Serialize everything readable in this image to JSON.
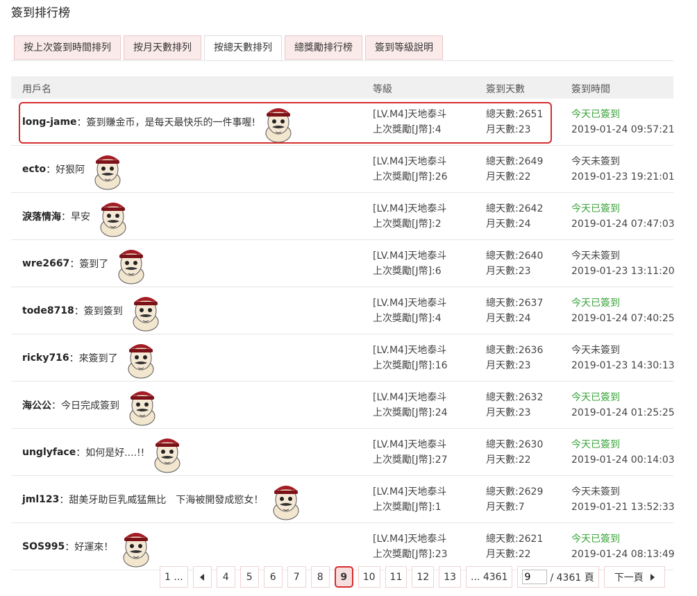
{
  "title": "簽到排行榜",
  "tabs": [
    "按上次簽到時間排列",
    "按月天數排列",
    "按總天數排列",
    "總獎勵排行榜",
    "簽到等級說明"
  ],
  "active_tab": 2,
  "columns": {
    "user": "用戶名",
    "level": "等級",
    "days": "簽到天數",
    "time": "簽到時間"
  },
  "rows": [
    {
      "user": "long-jame",
      "sep": "：",
      "msg": "簽到賺金币，是每天最快乐的一件事喔!",
      "level": "[LV.M4]天地泰斗",
      "reward": "上次獎勵[J幣]:4",
      "total": "總天數:2651",
      "month": "月天數:23",
      "status": "今天已簽到",
      "status_done": true,
      "time": "2019-01-24 09:57:21"
    },
    {
      "user": "ecto",
      "sep": "：",
      "msg": "好狠阿",
      "level": "[LV.M4]天地泰斗",
      "reward": "上次獎勵[J幣]:26",
      "total": "總天數:2649",
      "month": "月天數:22",
      "status": "今天未簽到",
      "status_done": false,
      "time": "2019-01-23 19:21:01"
    },
    {
      "user": "淚落情海",
      "sep": "：",
      "msg": "早安",
      "level": "[LV.M4]天地泰斗",
      "reward": "上次獎勵[J幣]:2",
      "total": "總天數:2642",
      "month": "月天數:24",
      "status": "今天已簽到",
      "status_done": true,
      "time": "2019-01-24 07:47:03"
    },
    {
      "user": "wre2667",
      "sep": "：",
      "msg": "簽到了",
      "level": "[LV.M4]天地泰斗",
      "reward": "上次獎勵[J幣]:6",
      "total": "總天數:2640",
      "month": "月天數:23",
      "status": "今天未簽到",
      "status_done": false,
      "time": "2019-01-23 13:11:20"
    },
    {
      "user": "tode8718",
      "sep": "：",
      "msg": "簽到簽到",
      "level": "[LV.M4]天地泰斗",
      "reward": "上次獎勵[J幣]:4",
      "total": "總天數:2637",
      "month": "月天數:24",
      "status": "今天已簽到",
      "status_done": true,
      "time": "2019-01-24 07:40:25"
    },
    {
      "user": "ricky716",
      "sep": "：",
      "msg": "來簽到了",
      "level": "[LV.M4]天地泰斗",
      "reward": "上次獎勵[J幣]:16",
      "total": "總天數:2636",
      "month": "月天數:23",
      "status": "今天未簽到",
      "status_done": false,
      "time": "2019-01-23 14:30:13"
    },
    {
      "user": "海公公",
      "sep": "：",
      "msg": "今日完成簽到",
      "level": "[LV.M4]天地泰斗",
      "reward": "上次獎勵[J幣]:24",
      "total": "總天數:2632",
      "month": "月天數:23",
      "status": "今天已簽到",
      "status_done": true,
      "time": "2019-01-24 01:25:25"
    },
    {
      "user": "unglyface",
      "sep": "：",
      "msg": "如何是好....!!",
      "level": "[LV.M4]天地泰斗",
      "reward": "上次獎勵[J幣]:27",
      "total": "總天數:2630",
      "month": "月天數:22",
      "status": "今天已簽到",
      "status_done": true,
      "time": "2019-01-24 00:14:03"
    },
    {
      "user": "jml123",
      "sep": "：",
      "msg": "甜美牙助巨乳威猛無比　下海被開發成慾女！",
      "level": "[LV.M4]天地泰斗",
      "reward": "上次獎勵[J幣]:1",
      "total": "總天數:2629",
      "month": "月天數:7",
      "status": "今天未簽到",
      "status_done": false,
      "time": "2019-01-21 13:52:33"
    },
    {
      "user": "SOS995",
      "sep": "：",
      "msg": "好運來！",
      "level": "[LV.M4]天地泰斗",
      "reward": "上次獎勵[J幣]:23",
      "total": "總天數:2621",
      "month": "月天數:22",
      "status": "今天已簽到",
      "status_done": true,
      "time": "2019-01-24 08:13:49"
    }
  ],
  "colors": {
    "done": "#3aa33a",
    "highlight": "#d62c2c",
    "tab_bg": "#fbeaea"
  },
  "pagination": {
    "first": "1 ...",
    "prev_icon": "triangle-left-icon",
    "pages": [
      "4",
      "5",
      "6",
      "7",
      "8",
      "9",
      "10",
      "11",
      "12",
      "13"
    ],
    "current": "9",
    "last": "... 4361",
    "input_value": "9",
    "total_label": "/ 4361 頁",
    "next_label": "下一頁",
    "next_icon": "triangle-right-icon"
  }
}
